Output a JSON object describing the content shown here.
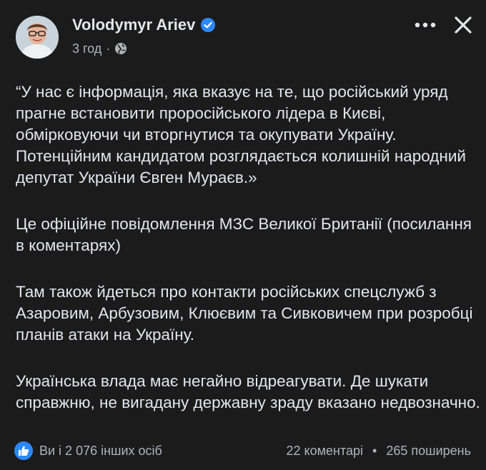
{
  "author": {
    "name": "Volodymyr Ariev",
    "verified": true
  },
  "meta": {
    "time": "3 год",
    "separator": "·",
    "audience_icon": "globe-icon"
  },
  "post": {
    "paragraphs": [
      "“У нас є інформація, яка вказує на те, що російський уряд прагне встановити проросійського лідера в Києві, обмірковуючи чи вторгнутися та окупувати Україну. Потенційним кандидатом розглядається колишній народний депутат України Євген Мураєв.»",
      "Це офіційне повідомлення МЗС Великої Британії (посилання в коментарях)",
      "Там також йдеться про контакти російських спецслужб з Азаровим, Арбузовим, Клюєвим та Сивковичем при розробці планів атаки на Україну.",
      "Українська влада має негайно відреагувати. Де шукати справжню, не вигадану державну зраду вказано недвозначно."
    ]
  },
  "footer": {
    "reactions": "Ви і 2 076 інших осіб",
    "comments": "22 коментарі",
    "separator": "•",
    "shares": "265 поширень"
  },
  "colors": {
    "background": "#1b1b1c",
    "text": "#e4e6eb",
    "secondary": "#b0b3b8",
    "accent": "#2d88ff"
  }
}
